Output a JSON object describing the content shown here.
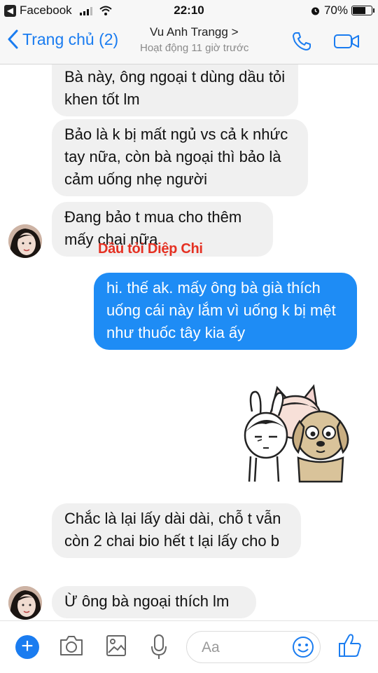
{
  "status_bar": {
    "app_name": "Facebook",
    "time": "22:10",
    "battery": "70%",
    "battery_level": 0.7
  },
  "header": {
    "back_label": "Trang chủ (2)",
    "contact_name": "Vu Anh Trangg >",
    "presence": "Hoạt động 11 giờ trước"
  },
  "messages": [
    {
      "text": "Bà này, ông ngoại t dùng dầu tỏi khen tốt lm"
    },
    {
      "text": "Bảo là k bị mất ngủ vs cả k nhức tay nữa, còn bà ngoại thì bảo là cảm uống nhẹ người"
    },
    {
      "text": "Đang bảo t mua cho thêm mấy chai nữa"
    },
    {
      "text": "hi. thế ak. mấy ông bà già thích uống cái này lắm vì uống k bị mệt như thuốc tây kia ấy"
    },
    {
      "text": "Chắc là lại lấy dài dài, chỗ t vẫn còn 2 chai bio hết t lại lấy cho b"
    },
    {
      "text": "Ừ ông bà ngoại thích lm"
    }
  ],
  "watermark": "Dầu tỏi Diệp Chi",
  "composer": {
    "placeholder": "Aa"
  },
  "colors": {
    "accent": "#1a7cf0",
    "outgoing_bubble": "#1e8cf5",
    "incoming_bubble": "#f0f0f0",
    "watermark": "#e53022"
  },
  "icons": [
    "back-chevron-icon",
    "phone-icon",
    "video-camera-icon",
    "plus-icon",
    "camera-icon",
    "image-icon",
    "microphone-icon",
    "smiley-icon",
    "thumbs-up-icon"
  ]
}
